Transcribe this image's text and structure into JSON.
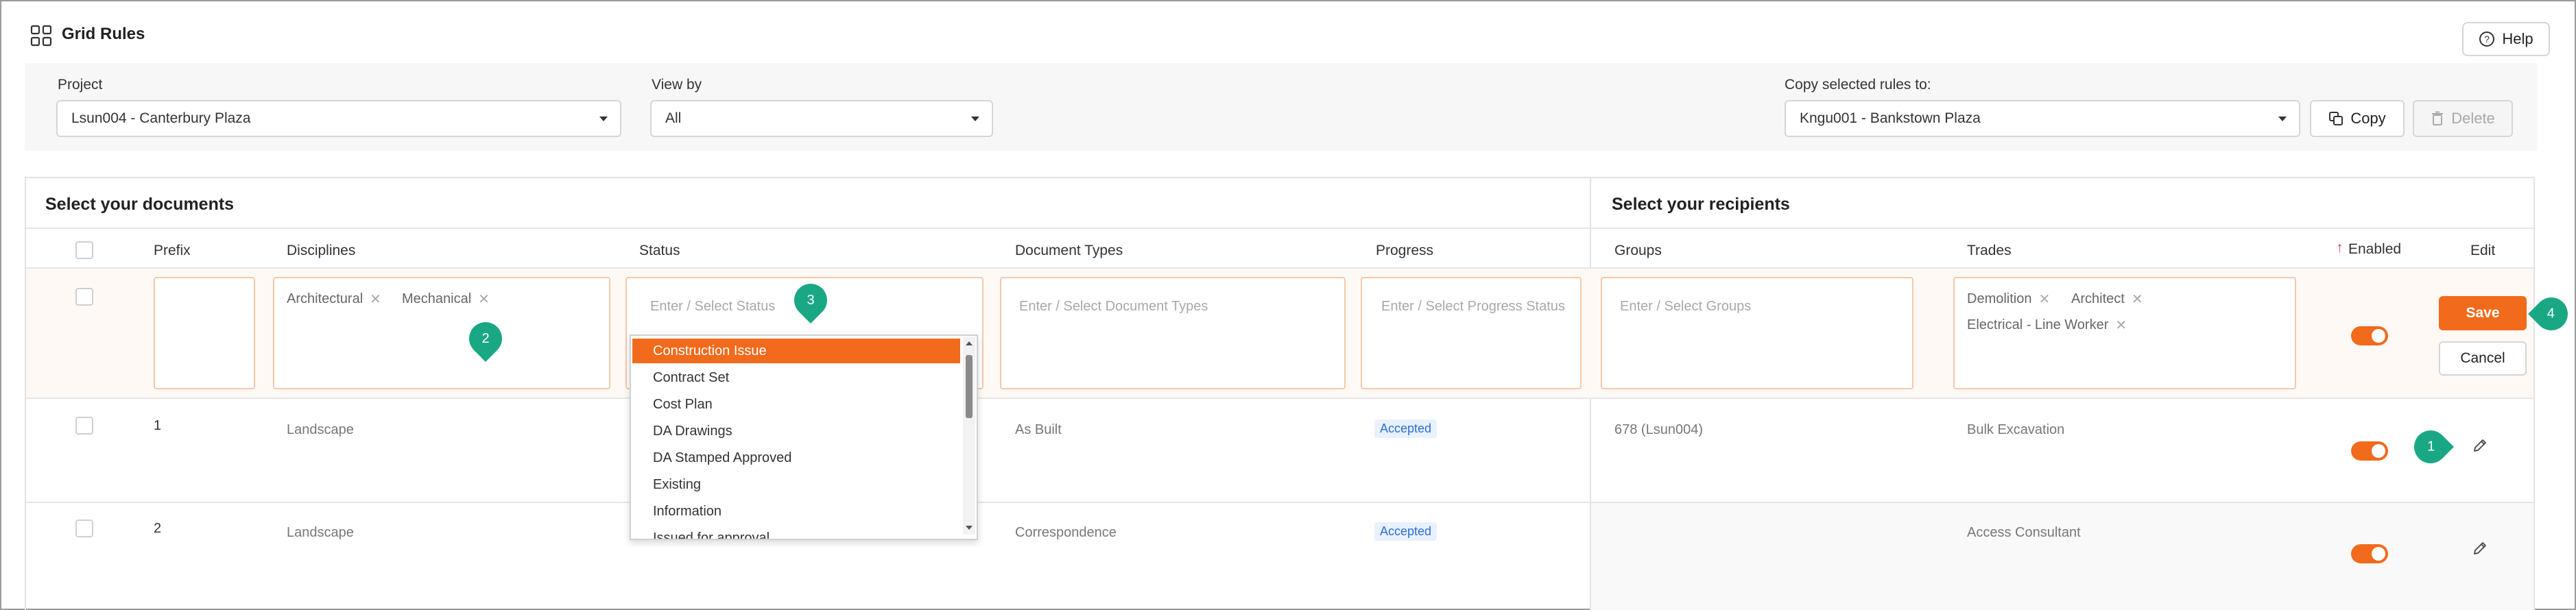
{
  "app": {
    "title": "Grid Rules",
    "help_label": "Help"
  },
  "filters": {
    "project_label": "Project",
    "project_value": "Lsun004 - Canterbury Plaza",
    "viewby_label": "View by",
    "viewby_value": "All",
    "copy_label": "Copy selected rules to:",
    "copy_value": "Kngu001 - Bankstown Plaza",
    "copy_button": "Copy",
    "delete_button": "Delete"
  },
  "documents": {
    "title": "Select your documents",
    "headers": [
      "Prefix",
      "Disciplines",
      "Status",
      "Document Types",
      "Progress"
    ]
  },
  "recipients": {
    "title": "Select your recipients",
    "headers": [
      "Groups",
      "Trades",
      "Enabled",
      "Edit"
    ],
    "enabled_sort": "↑"
  },
  "edit_row": {
    "disciplines": [
      "Architectural",
      "Mechanical"
    ],
    "status_placeholder": "Enter / Select Status",
    "doctypes_placeholder": "Enter / Select Document Types",
    "progress_placeholder": "Enter / Select Progress Status",
    "groups_placeholder": "Enter / Select Groups",
    "trades": [
      "Demolition",
      "Architect",
      "Electrical - Line Worker"
    ],
    "save_label": "Save",
    "cancel_label": "Cancel",
    "enabled": true
  },
  "status_options": [
    "Construction Issue",
    "Contract Set",
    "Cost Plan",
    "DA Drawings",
    "DA Stamped Approved",
    "Existing",
    "Information",
    "Issued for approval"
  ],
  "status_selected": "Construction Issue",
  "rows": [
    {
      "prefix": "1",
      "discipline": "Landscape",
      "doctype": "As Built",
      "progress": "Accepted",
      "group": "678 (Lsun004)",
      "trade": "Bulk Excavation",
      "enabled": true
    },
    {
      "prefix": "2",
      "discipline": "Landscape",
      "doctype": "Correspondence",
      "progress": "Accepted",
      "group": "",
      "trade": "Access Consultant",
      "enabled": true
    }
  ],
  "annotations": [
    "1",
    "2",
    "3",
    "4"
  ],
  "colors": {
    "accent": "#f26a1b",
    "annotation": "#1aa784",
    "badge_bg": "#e8f1fd",
    "badge_text": "#2c6fd0"
  }
}
